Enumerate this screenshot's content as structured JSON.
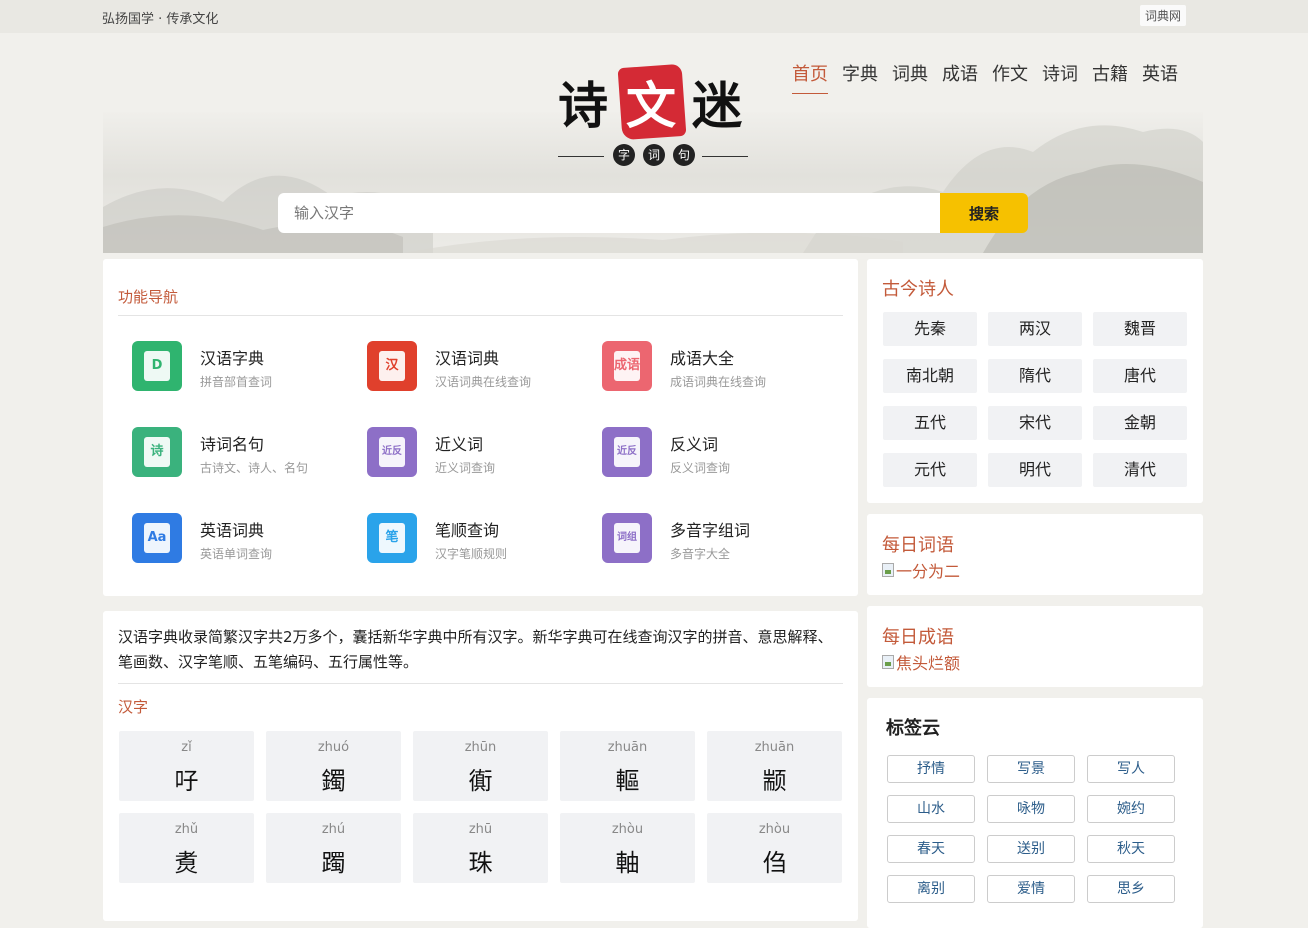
{
  "topbar": {
    "slogan": "弘扬国学 · 传承文化",
    "site_link": "词典网"
  },
  "logo": {
    "chars": [
      "诗",
      "文",
      "迷"
    ],
    "sub": [
      "字",
      "词",
      "句"
    ]
  },
  "nav": [
    "首页",
    "字典",
    "词典",
    "成语",
    "作文",
    "诗词",
    "古籍",
    "英语"
  ],
  "search": {
    "placeholder": "输入汉字",
    "value": "",
    "button": "搜索"
  },
  "func_nav": {
    "title": "功能导航",
    "items": [
      {
        "name": "汉语字典",
        "desc": "拼音部首查词",
        "icon": "dictionary-d-icon",
        "glyph": "D",
        "color": "#2fb46f"
      },
      {
        "name": "汉语词典",
        "desc": "汉语词典在线查询",
        "icon": "han-book-icon",
        "glyph": "汉",
        "color": "#e0402c"
      },
      {
        "name": "成语大全",
        "desc": "成语词典在线查询",
        "icon": "idiom-book-icon",
        "glyph": "成语",
        "color": "#ec6670"
      },
      {
        "name": "诗词名句",
        "desc": "古诗文、诗人、名句",
        "icon": "poem-book-icon",
        "glyph": "诗",
        "color": "#3ab27d"
      },
      {
        "name": "近义词",
        "desc": "近义词查询",
        "icon": "synonym-icon",
        "glyph": "近|反",
        "color": "#8d6fc7"
      },
      {
        "name": "反义词",
        "desc": "反义词查询",
        "icon": "antonym-icon",
        "glyph": "近|反",
        "color": "#8d6fc7"
      },
      {
        "name": "英语词典",
        "desc": "英语单词查询",
        "icon": "english-aa-icon",
        "glyph": "Aa",
        "color": "#2f7be3"
      },
      {
        "name": "笔顺查询",
        "desc": "汉字笔顺规则",
        "icon": "brush-stroke-icon",
        "glyph": "笔",
        "color": "#2aa3ea"
      },
      {
        "name": "多音字组词",
        "desc": "多音字大全",
        "icon": "polyphone-icon",
        "glyph": "词|组",
        "color": "#8d6fc7"
      }
    ]
  },
  "intro": {
    "text": "汉语字典收录简繁汉字共2万多个，囊括新华字典中所有汉字。新华字典可在线查询汉字的拼音、意思解释、笔画数、汉字笔顺、五笔编码、五行属性等。",
    "title": "汉字"
  },
  "hanzi": [
    {
      "py": "zǐ",
      "ch": "吇"
    },
    {
      "py": "zhuó",
      "ch": "鐲"
    },
    {
      "py": "zhūn",
      "ch": "衠"
    },
    {
      "py": "zhuān",
      "ch": "䡱"
    },
    {
      "py": "zhuān",
      "ch": "颛"
    },
    {
      "py": "zhǔ",
      "ch": "煑"
    },
    {
      "py": "zhú",
      "ch": "躅"
    },
    {
      "py": "zhū",
      "ch": "珠"
    },
    {
      "py": "zhòu",
      "ch": "軸"
    },
    {
      "py": "zhòu",
      "ch": "㑇"
    }
  ],
  "poets": {
    "title": "古今诗人",
    "eras": [
      "先秦",
      "两汉",
      "魏晋",
      "南北朝",
      "隋代",
      "唐代",
      "五代",
      "宋代",
      "金朝",
      "元代",
      "明代",
      "清代"
    ]
  },
  "daily_word": {
    "title": "每日词语",
    "alt": "一分为二"
  },
  "daily_idiom": {
    "title": "每日成语",
    "alt": "焦头烂额"
  },
  "tags": {
    "title": "标签云",
    "items": [
      "抒情",
      "写景",
      "写人",
      "山水",
      "咏物",
      "婉约",
      "春天",
      "送别",
      "秋天",
      "离别",
      "爱情",
      "思乡"
    ]
  }
}
